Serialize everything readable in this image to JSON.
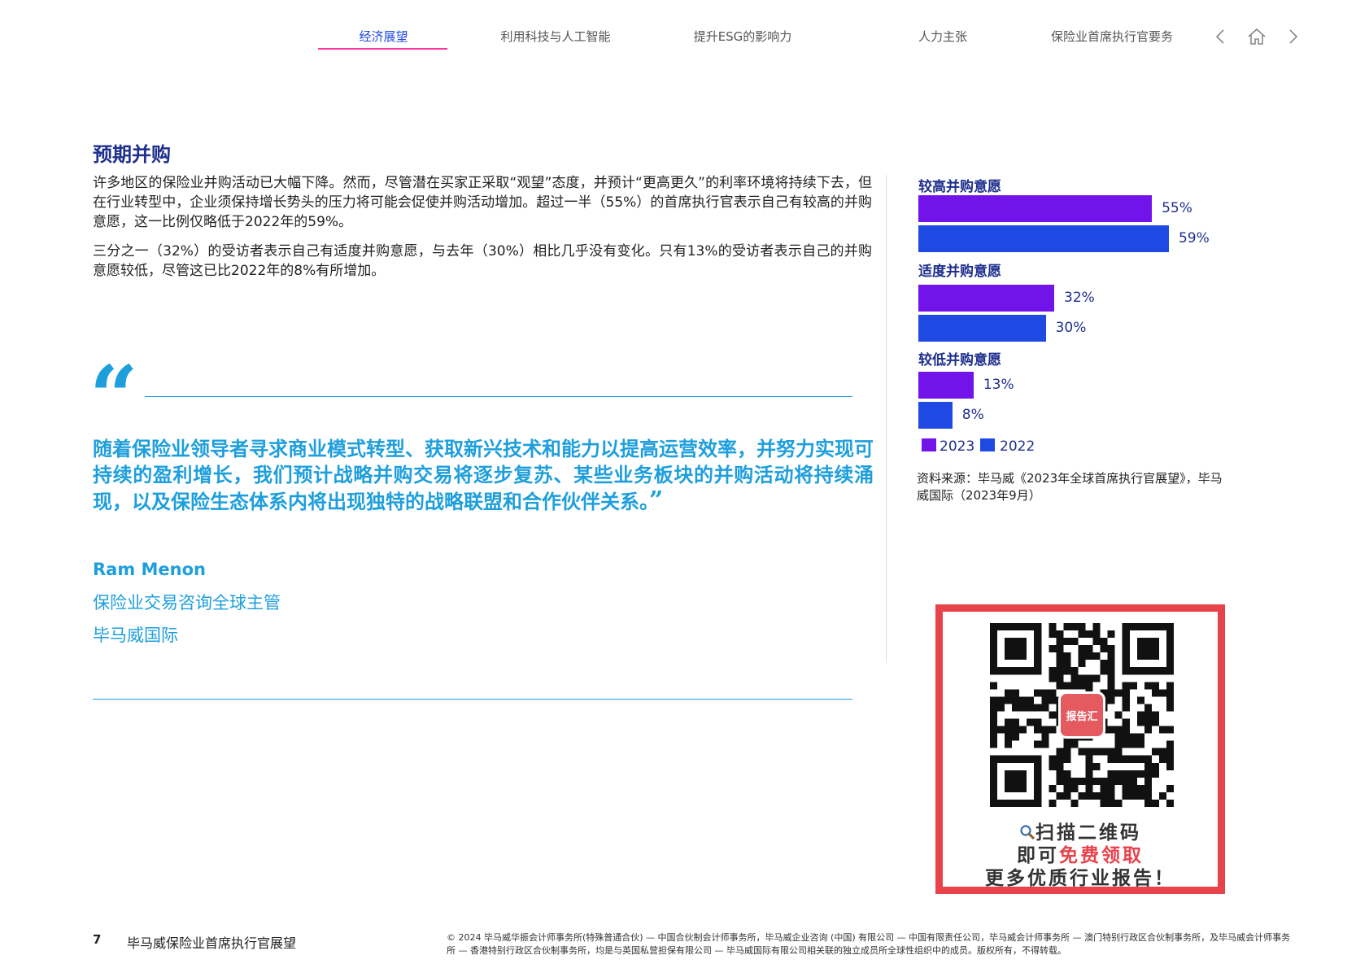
{
  "nav": {
    "tabs": [
      {
        "label": "经济展望",
        "active": true
      },
      {
        "label": "利用科技与人工智能",
        "active": false
      },
      {
        "label": "提升ESG的影响力",
        "active": false
      },
      {
        "label": "人力主张",
        "active": false
      },
      {
        "label": "保险业首席执行官要务",
        "active": false
      }
    ],
    "icons": [
      "chevron-left-icon",
      "home-icon",
      "chevron-right-icon"
    ],
    "accent_color": "#fd349c",
    "active_color": "#1e49e2"
  },
  "section": {
    "heading": "预期并购",
    "paragraphs": [
      "许多地区的保险业并购活动已大幅下降。然而，尽管潜在买家正采取“观望”态度，并预计“更高更久”的利率环境将持续下去，但在行业转型中，企业须保持增长势头的压力将可能会促使并购活动增加。超过一半（55%）的首席执行官表示自己有较高的并购意愿，这一比例仅略低于2022年的59%。",
      "三分之一（32%）的受访者表示自己有适度并购意愿，与去年（30%）相比几乎没有变化。只有13%的受访者表示自己的并购意愿较低，尽管这已比2022年的8%有所增加。"
    ]
  },
  "quote": {
    "open_mark": "“",
    "text": "随着保险业领导者寻求商业模式转型、获取新兴技术和能力以提高运营效率，并努力实现可持续的盈利增长，我们预计战略并购交易将逐步复苏、某些业务板块的并购活动将持续涌现，以及保险生态体系内将出现独特的战略联盟和合作伙伴关系。",
    "close_mark": "”",
    "author": "Ram Menon",
    "author_title": "保险业交易咨询全球主管",
    "author_org": "毕马威国际",
    "color": "#1e9fdc"
  },
  "chart_data": {
    "type": "bar",
    "orientation": "horizontal",
    "categories": [
      "较高并购意愿",
      "适度并购意愿",
      "较低并购意愿"
    ],
    "series": [
      {
        "name": "2023",
        "values": [
          55,
          32,
          13
        ],
        "labels": [
          "55%",
          "32%",
          "13%"
        ],
        "color": "#7213ea"
      },
      {
        "name": "2022",
        "values": [
          59,
          30,
          8
        ],
        "labels": [
          "59%",
          "30%",
          "8%"
        ],
        "color": "#1e49e2"
      }
    ],
    "xlim": [
      0,
      100
    ],
    "grid": false,
    "legend": "bottom-left",
    "source": "资料来源：毕马威《2023年全球首席执行官展望》，毕马威国际（2023年9月）"
  },
  "qr": {
    "center_label": "报告汇",
    "line1": "扫描二维码",
    "line2_prefix": "即可",
    "line2_highlight": "免费领取",
    "line3": "更多优质行业报告！",
    "border_color": "#e8434a"
  },
  "footer": {
    "page_number": "7",
    "title": "毕马威保险业首席执行官展望",
    "copyright": "© 2024 毕马威华振会计师事务所(特殊普通合伙) — 中国合伙制会计师事务所，毕马威企业咨询 (中国) 有限公司 — 中国有限责任公司，毕马威会计师事务所 — 澳门特别行政区合伙制事务所，及毕马威会计师事务所 — 香港特别行政区合伙制事务所，均是与英国私营担保有限公司 — 毕马威国际有限公司相关联的独立成员所全球性组织中的成员。版权所有，不得转载。"
  }
}
